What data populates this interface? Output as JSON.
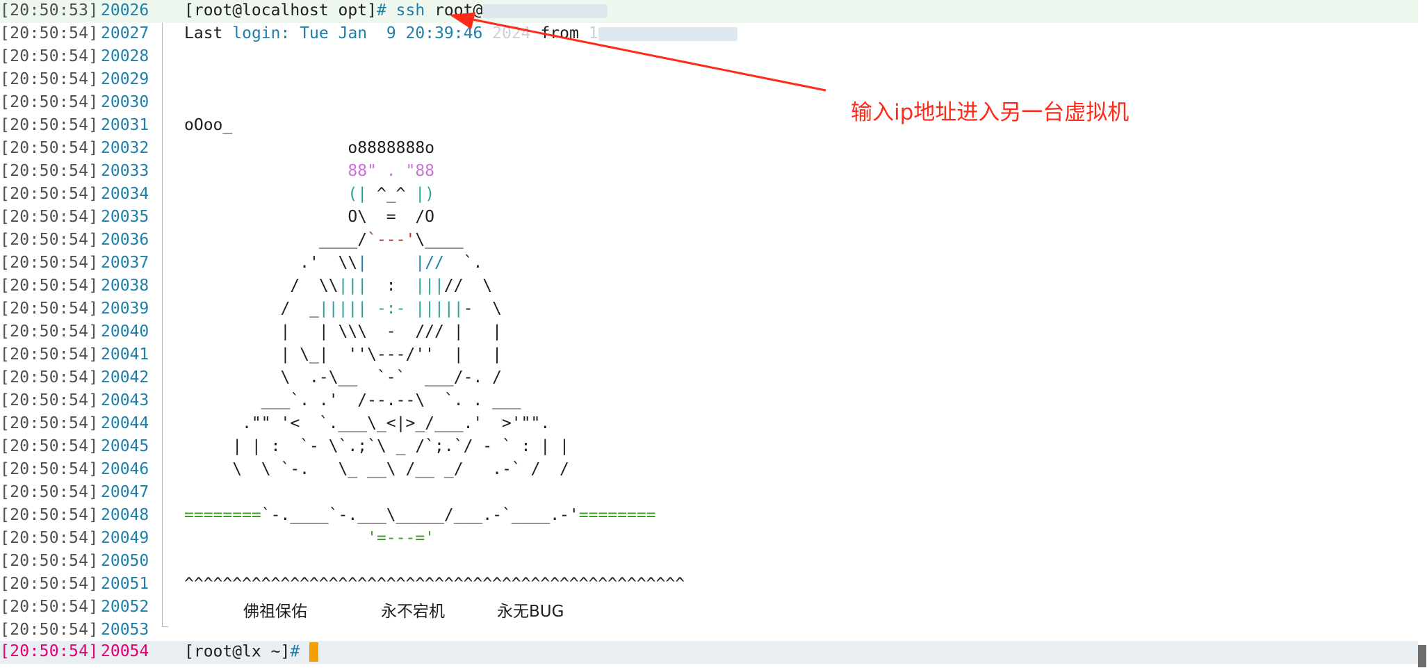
{
  "lines": [
    {
      "ts": "[20:50:53]",
      "num": "20026"
    },
    {
      "ts": "[20:50:54]",
      "num": "20027"
    },
    {
      "ts": "[20:50:54]",
      "num": "20028"
    },
    {
      "ts": "[20:50:54]",
      "num": "20029"
    },
    {
      "ts": "[20:50:54]",
      "num": "20030"
    },
    {
      "ts": "[20:50:54]",
      "num": "20031"
    },
    {
      "ts": "[20:50:54]",
      "num": "20032"
    },
    {
      "ts": "[20:50:54]",
      "num": "20033"
    },
    {
      "ts": "[20:50:54]",
      "num": "20034"
    },
    {
      "ts": "[20:50:54]",
      "num": "20035"
    },
    {
      "ts": "[20:50:54]",
      "num": "20036"
    },
    {
      "ts": "[20:50:54]",
      "num": "20037"
    },
    {
      "ts": "[20:50:54]",
      "num": "20038"
    },
    {
      "ts": "[20:50:54]",
      "num": "20039"
    },
    {
      "ts": "[20:50:54]",
      "num": "20040"
    },
    {
      "ts": "[20:50:54]",
      "num": "20041"
    },
    {
      "ts": "[20:50:54]",
      "num": "20042"
    },
    {
      "ts": "[20:50:54]",
      "num": "20043"
    },
    {
      "ts": "[20:50:54]",
      "num": "20044"
    },
    {
      "ts": "[20:50:54]",
      "num": "20045"
    },
    {
      "ts": "[20:50:54]",
      "num": "20046"
    },
    {
      "ts": "[20:50:54]",
      "num": "20047"
    },
    {
      "ts": "[20:50:54]",
      "num": "20048"
    },
    {
      "ts": "[20:50:54]",
      "num": "20049"
    },
    {
      "ts": "[20:50:54]",
      "num": "20050"
    },
    {
      "ts": "[20:50:54]",
      "num": "20051"
    },
    {
      "ts": "[20:50:54]",
      "num": "20052"
    },
    {
      "ts": "[20:50:54]",
      "num": "20053"
    },
    {
      "ts": "[20:50:54]",
      "num": "20054"
    }
  ],
  "cmd": {
    "prompt": "[root@localhost opt]",
    "hash": "#",
    "ssh": "ssh",
    "target": "root@"
  },
  "login": {
    "last": "Last",
    "login_word": "login:",
    "date": "Tue Jan  9 20:39:46",
    "year": "2024",
    "from": "from",
    "host_partial": "1"
  },
  "art": {
    "l31": "oOoo_",
    "l32": "                 o8888888o",
    "l33": "                 88\" . \"88",
    "l34": [
      "                 (| ",
      "^_^",
      " |)"
    ],
    "l35": "                 O\\  =  /O",
    "l36": [
      "              ____/",
      "`---'",
      "\\____"
    ],
    "l37": [
      "            .'  \\\\",
      "|",
      "     ",
      "|//",
      "  `."
    ],
    "l38": [
      "           /  \\\\",
      "|||",
      "  :  ",
      "|||",
      "//  \\"
    ],
    "l39": [
      "          /  _",
      "||||| -:- |||||",
      "-  \\"
    ],
    "l40": [
      "          |   | \\\\\\  -  /// |   |"
    ],
    "l41": [
      "          | \\_|  ''\\---/''  |   |"
    ],
    "l42": [
      "          \\  .-\\__  `-`  ___/-. /"
    ],
    "l43": [
      "        ___`. .'  /--.--\\  `. . ___"
    ],
    "l44": [
      "      .\"\" '<  `.___\\_<|>_/___.'  >'\"\"."
    ],
    "l45": [
      "     | | :  `- \\`.;`\\ _ /`;.`/ - ` : | |"
    ],
    "l46": [
      "     \\  \\ `-.   \\_ __\\ /__ _/   .-` /  /"
    ],
    "l48": [
      "========",
      "`-.____`-.___\\_____/___.-`____.-'",
      "========"
    ],
    "l49": "                   '=---='",
    "l51": "^^^^^^^^^^^^^^^^^^^^^^^^^^^^^^^^^^^^^^^^^^^^^^^^^^^^",
    "blessing": [
      "佛祖保佑",
      "永不宕机",
      "永无BUG"
    ]
  },
  "prompt2": {
    "text": "[root@lx ~]",
    "hash": "#"
  },
  "annotation": "输入ip地址进入另一台虚拟机",
  "colors": {
    "annotation": "#ff2a1a",
    "cursor": "#f5a000",
    "line_number": "#1f7fa8",
    "current_line": "#e0006f"
  }
}
